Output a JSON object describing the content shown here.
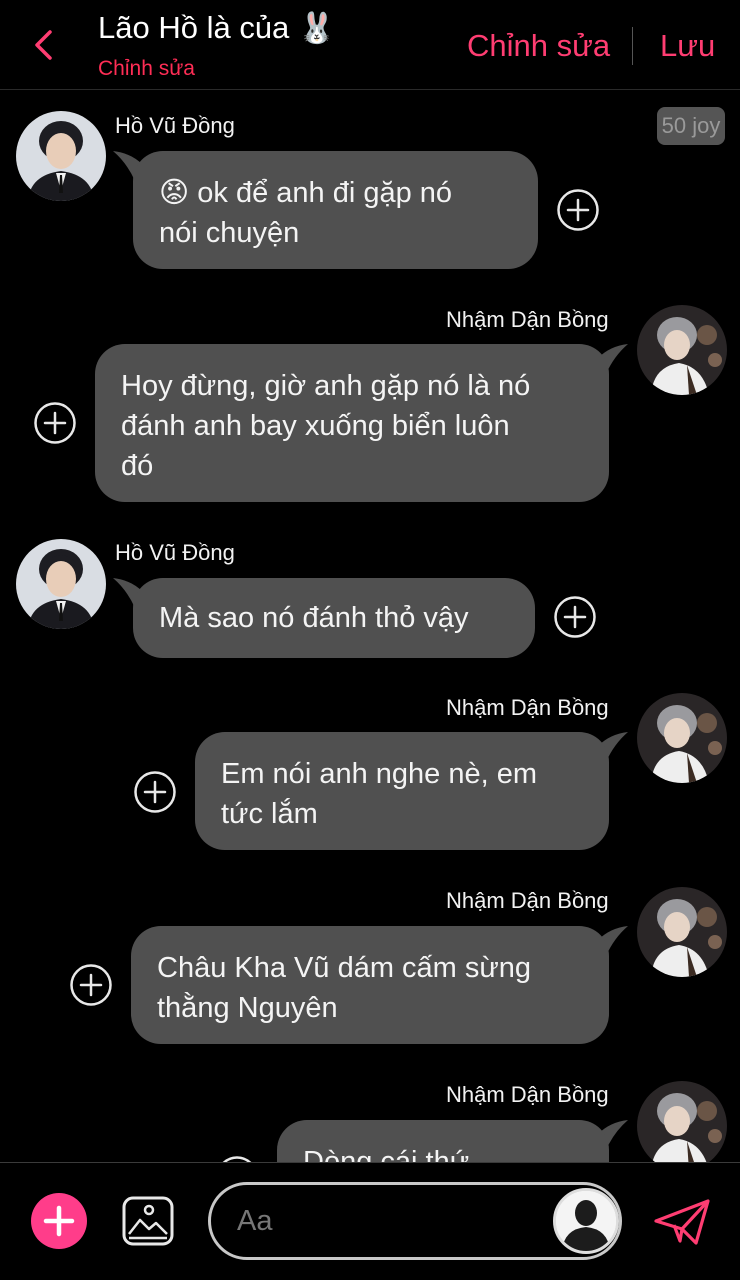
{
  "header": {
    "title": "Lão Hồ là của",
    "title_emoji": "🐰",
    "subtitle": "Chỉnh sửa",
    "edit_label": "Chỉnh sửa",
    "save_label": "Lưu",
    "accent_color": "#ff3d72"
  },
  "chat": {
    "joy_badge": "50 joy",
    "messages": [
      {
        "side": "left",
        "sender": "Hồ Vũ Đồng",
        "text_lines": [
          "😡 ok để anh đi gặp nó",
          "nói chuyện"
        ]
      },
      {
        "side": "right",
        "sender": "Nhậm Dận Bồng",
        "text_lines": [
          "Hoy đừng, giờ anh gặp nó là nó",
          "đánh anh bay xuống biển luôn",
          "đó"
        ]
      },
      {
        "side": "left",
        "sender": "Hồ Vũ Đồng",
        "text_lines": [
          "Mà sao nó đánh thỏ vậy"
        ]
      },
      {
        "side": "right",
        "sender": "Nhậm Dận Bồng",
        "text_lines": [
          "Em nói anh nghe nè, em",
          "tức lắm"
        ]
      },
      {
        "side": "right",
        "sender": "Nhậm Dận Bồng",
        "text_lines": [
          "Châu Kha Vũ dám cấm sừng",
          "thằng Nguyên"
        ]
      },
      {
        "side": "right",
        "sender": "Nhậm Dận Bồng",
        "text_lines": [
          "Dòng cái thứ"
        ]
      }
    ]
  },
  "composer": {
    "placeholder": "Aa",
    "value": ""
  },
  "icons": {
    "back": "chevron-left-icon",
    "add": "plus-icon",
    "gallery": "image-icon",
    "persona": "user-silhouette-icon",
    "send": "paper-plane-icon",
    "react": "plus-circle-icon"
  }
}
